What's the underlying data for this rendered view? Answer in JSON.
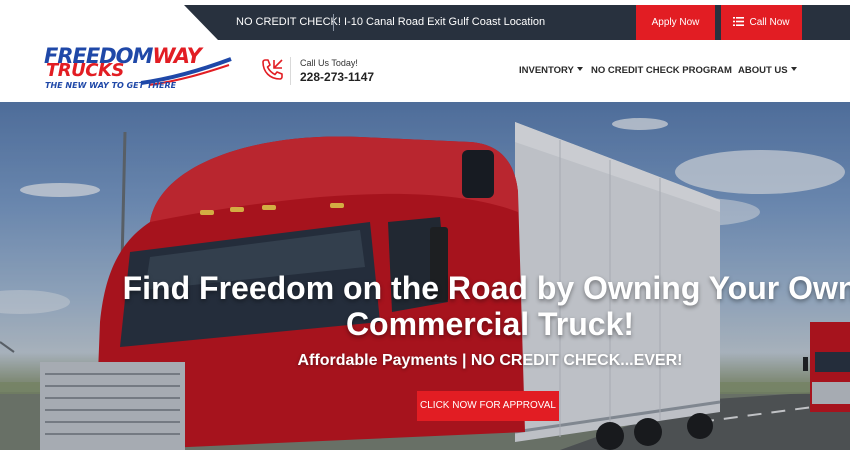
{
  "topbar": {
    "no_credit": "NO CREDIT CHECK!",
    "location": "I-10 Canal Road Exit Gulf Coast Location",
    "apply_label": "Apply Now",
    "call_label": "Call Now"
  },
  "header": {
    "logo": {
      "line1_a": "FREEDOM",
      "line1_b": "WAY",
      "line2": "TRUCKS",
      "tagline": "THE NEW WAY TO GET THERE"
    },
    "call_label": "Call Us Today!",
    "phone": "228-273-1147",
    "nav": {
      "inventory": "INVENTORY",
      "no_credit_program": "NO CREDIT CHECK PROGRAM",
      "about": "ABOUT US"
    }
  },
  "hero": {
    "title_line1": "Find Freedom on the Road by Owning Your Own",
    "title_line2": "Commercial Truck!",
    "subtitle": "Affordable Payments | NO CREDIT CHECK...EVER!",
    "cta": "CLICK NOW FOR APPROVAL"
  },
  "colors": {
    "accent_red": "#e21d23",
    "topbar_dark": "#28313e",
    "logo_blue": "#1f48a8"
  },
  "icons": [
    "menu-icon",
    "phone-icon",
    "caret-down-icon"
  ]
}
